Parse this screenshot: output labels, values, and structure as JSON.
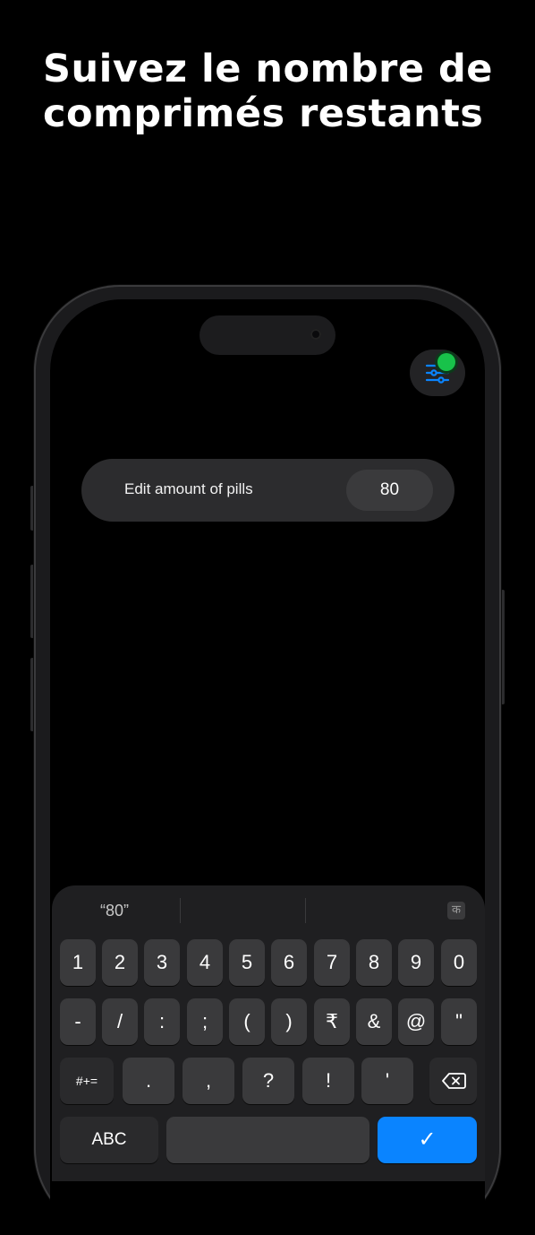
{
  "headline": {
    "line1": "Suivez le nombre de",
    "line2": "comprimés restants"
  },
  "settings": {
    "icon": "sliders-icon",
    "badge_color": "#18c24a",
    "icon_color": "#0a84ff"
  },
  "edit": {
    "label": "Edit amount of pills",
    "value": "80"
  },
  "keyboard": {
    "suggestion": "“80”",
    "lang_key": "क",
    "row1": [
      "1",
      "2",
      "3",
      "4",
      "5",
      "6",
      "7",
      "8",
      "9",
      "0"
    ],
    "row2": [
      "-",
      "/",
      ":",
      ";",
      "(",
      ")",
      "₹",
      "&",
      "@",
      "\""
    ],
    "row3": [
      "#+=",
      ".",
      ",",
      "?",
      "!",
      "'"
    ],
    "row4": {
      "abc": "ABC",
      "space": "",
      "done": "✓"
    }
  }
}
